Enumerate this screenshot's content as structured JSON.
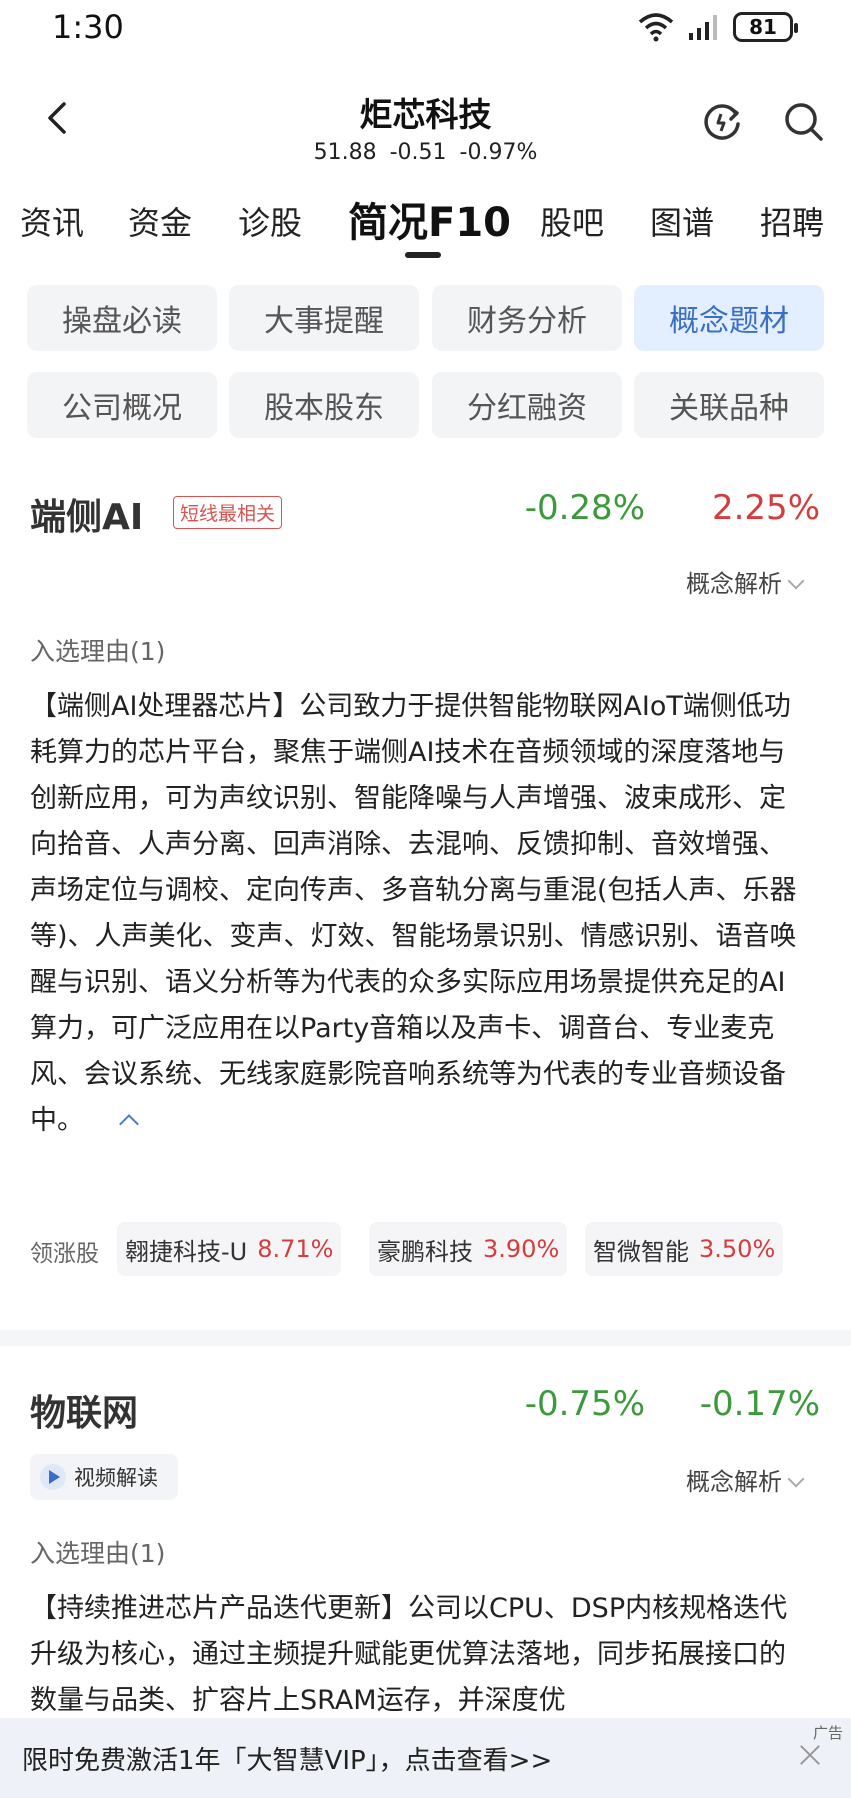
{
  "status_bar": {
    "time": "1:30",
    "battery": "81"
  },
  "header": {
    "title": "炬芯科技",
    "price": "51.88",
    "change": "-0.51",
    "change_pct": "-0.97%"
  },
  "tabs": [
    "资讯",
    "资金",
    "诊股",
    "简况F10",
    "股吧",
    "图谱",
    "招聘"
  ],
  "active_tab": "简况F10",
  "sub_buttons": [
    [
      "操盘必读",
      "大事提醒",
      "财务分析",
      "概念题材"
    ],
    [
      "公司概况",
      "股本股东",
      "分红融资",
      "关联品种"
    ]
  ],
  "active_sub_button": "概念题材",
  "concepts": [
    {
      "name": "端侧AI",
      "tag": "短线最相关",
      "pct1": "-0.28%",
      "pct2": "2.25%",
      "analysis_label": "概念解析",
      "reason_label": "入选理由(1)",
      "reason_text": "【端侧AI处理器芯片】公司致力于提供智能物联网AIoT端侧低功耗算力的芯片平台，聚焦于端侧AI技术在音频领域的深度落地与创新应用，可为声纹识别、智能降噪与人声增强、波束成形、定向拾音、人声分离、回声消除、去混响、反馈抑制、音效增强、声场定位与调校、定向传声、多音轨分离与重混(包括人声、乐器等)、人声美化、变声、灯效、智能场景识别、情感识别、语音唤醒与识别、语义分析等为代表的众多实际应用场景提供充足的AI算力，可广泛应用在以Party音箱以及声卡、调音台、专业麦克风、会议系统、无线家庭影院音响系统等为代表的专业音频设备中。",
      "leaders_label": "领涨股",
      "leaders": [
        {
          "name": "翱捷科技-U",
          "pct": "8.71%"
        },
        {
          "name": "豪鹏科技",
          "pct": "3.90%"
        },
        {
          "name": "智微智能",
          "pct": "3.50%"
        }
      ]
    },
    {
      "name": "物联网",
      "pct1": "-0.75%",
      "pct2": "-0.17%",
      "video_label": "视频解读",
      "analysis_label": "概念解析",
      "reason_label": "入选理由(1)",
      "reason_text": "【持续推进芯片产品迭代更新】公司以CPU、DSP内核规格迭代升级为核心，通过主频提升赋能更优算法落地，同步拓展接口的数量与品类、扩容片上SRAM运存，并深度优"
    }
  ],
  "ad": {
    "text": "限时免费激活1年「大智慧VIP」，点击查看>>",
    "tag": "广告"
  },
  "colors": {
    "accent_blue": "#3a6fc4",
    "up_red": "#d43d3d",
    "down_green": "#3c9a3c"
  }
}
